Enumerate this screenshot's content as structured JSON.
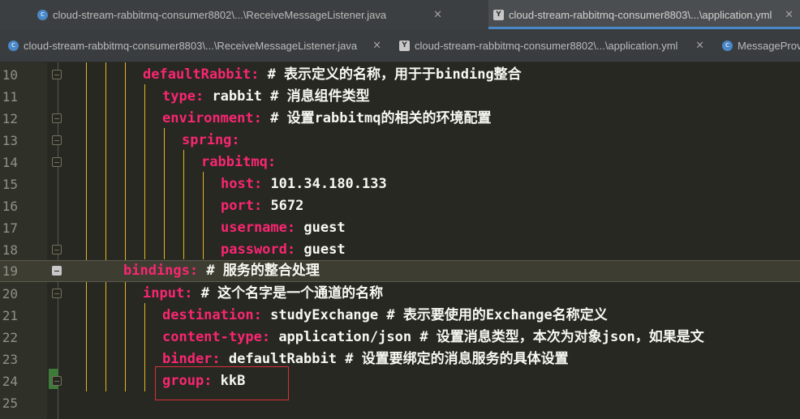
{
  "tabs_row1": [
    {
      "icon": "c",
      "label": "cloud-stream-rabbitmq-consumer8802\\...\\ReceiveMessageListener.java",
      "close": "×"
    },
    {
      "icon": "y",
      "label": "cloud-stream-rabbitmq-consumer8803\\...\\application.yml",
      "close": "×",
      "active": true
    }
  ],
  "tabs_row2": [
    {
      "icon": "c",
      "label": "cloud-stream-rabbitmq-consumer8803\\...\\ReceiveMessageListener.java",
      "close": "×"
    },
    {
      "icon": "y",
      "label": "cloud-stream-rabbitmq-consumer8802\\...\\application.yml",
      "close": "×"
    },
    {
      "icon": "c",
      "label": "MessageProvi"
    }
  ],
  "colors": {
    "key": "#f92672",
    "comment": "#f8f8f2",
    "background": "#272822",
    "guide": "#e6b422",
    "highlight_box": "#d9313a"
  },
  "lines": [
    {
      "num": "10",
      "indent": "        ",
      "key": "defaultRabbit",
      "sep": ":",
      "value": "",
      "comment": "# 表示定义的名称，用于于binding整合"
    },
    {
      "num": "11",
      "indent": "          ",
      "key": "type",
      "sep": ":",
      "value": " rabbit ",
      "comment": "# 消息组件类型"
    },
    {
      "num": "12",
      "indent": "          ",
      "key": "environment",
      "sep": ":",
      "value": " ",
      "comment": "# 设置rabbitmq的相关的环境配置"
    },
    {
      "num": "13",
      "indent": "            ",
      "key": "spring",
      "sep": ":",
      "value": "",
      "comment": ""
    },
    {
      "num": "14",
      "indent": "              ",
      "key": "rabbitmq",
      "sep": ":",
      "value": "",
      "comment": ""
    },
    {
      "num": "15",
      "indent": "                ",
      "key": "host",
      "sep": ":",
      "value": " 101.34.180.133",
      "comment": ""
    },
    {
      "num": "16",
      "indent": "                ",
      "key": "port",
      "sep": ":",
      "value": " 5672",
      "comment": ""
    },
    {
      "num": "17",
      "indent": "                ",
      "key": "username",
      "sep": ":",
      "value": " guest",
      "comment": ""
    },
    {
      "num": "18",
      "indent": "                ",
      "key": "password",
      "sep": ":",
      "value": " guest",
      "comment": ""
    },
    {
      "num": "19",
      "indent": "      ",
      "key": "bindings",
      "sep": ":",
      "value": " ",
      "comment": "# 服务的整合处理"
    },
    {
      "num": "20",
      "indent": "        ",
      "key": "input",
      "sep": ":",
      "value": " ",
      "comment": "# 这个名字是一个通道的名称"
    },
    {
      "num": "21",
      "indent": "          ",
      "key": "destination",
      "sep": ":",
      "value": " studyExchange ",
      "comment": "# 表示要使用的Exchange名称定义"
    },
    {
      "num": "22",
      "indent": "          ",
      "key": "content-type",
      "sep": ":",
      "value": " application/json ",
      "comment": "# 设置消息类型，本次为对象json，如果是文"
    },
    {
      "num": "23",
      "indent": "          ",
      "key": "binder",
      "sep": ":",
      "value": " defaultRabbit ",
      "comment": "# 设置要绑定的消息服务的具体设置"
    },
    {
      "num": "24",
      "indent": "          ",
      "key": "group",
      "sep": ":",
      "value": " kkB",
      "comment": ""
    },
    {
      "num": "25",
      "indent": "",
      "key": "",
      "sep": "",
      "value": "",
      "comment": ""
    }
  ]
}
